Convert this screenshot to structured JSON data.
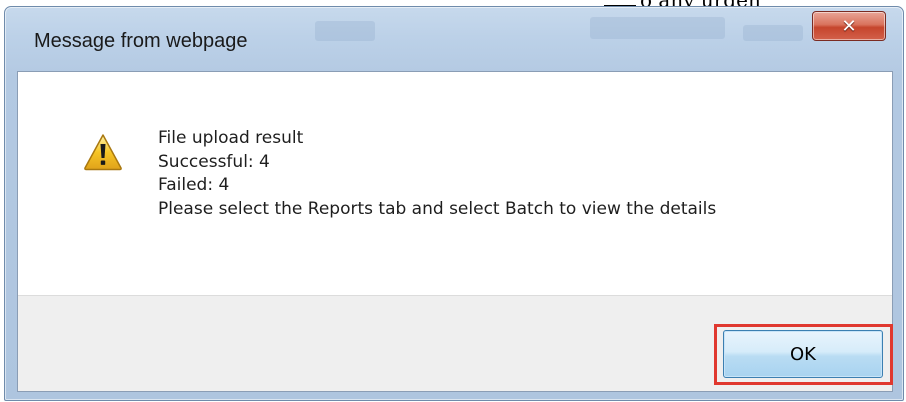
{
  "page": {
    "snippet_fragment": "o any urgen"
  },
  "dialog": {
    "title": "Message from webpage",
    "close_glyph": "✕",
    "icon": "warning-icon",
    "message_lines": [
      "File upload result",
      "Successful: 4",
      "Failed: 4",
      "Please select the Reports tab and select Batch to view the details"
    ],
    "ok_label": "OK"
  },
  "colors": {
    "title_bar": "#bcd1e8",
    "close_button": "#c6452c",
    "highlight": "#e0382f",
    "ok_button": "#d6ecfa",
    "warning_yellow": "#f6c526"
  }
}
